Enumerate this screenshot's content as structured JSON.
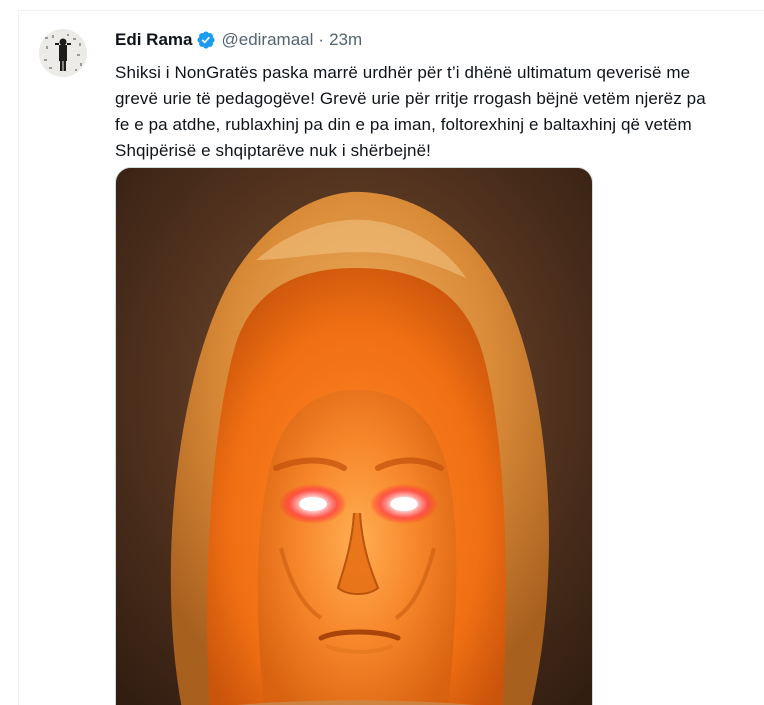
{
  "tweet": {
    "author_name": "Edi Rama",
    "handle": "@ediramaal",
    "separator": "·",
    "timestamp": "23m",
    "verified": true,
    "text_lines": [
      "Shiksi i NonGratës paska marrë urdhër për t’i dhënë ultimatum qeverisë me",
      "grevë urie të pedagogëve! Grevë urie për rritje rrogash bëjnë vetëm njerëz pa",
      "fe e pa atdhe, rublaxhinj pa din e pa iman, foltorexhinj e baltaxhinj që vetëm",
      "Shqipërisë e shqiptarëve nuk i shërbejnë!"
    ]
  },
  "icons": {
    "verified": "verified-badge-icon",
    "avatar": "profile-avatar"
  },
  "colors": {
    "verified_blue": "#1d9bf0",
    "text_primary": "#0f1419",
    "text_secondary": "#536471",
    "pumpkin": "#f07a1e",
    "eye_glow": "#ff3b3b"
  }
}
